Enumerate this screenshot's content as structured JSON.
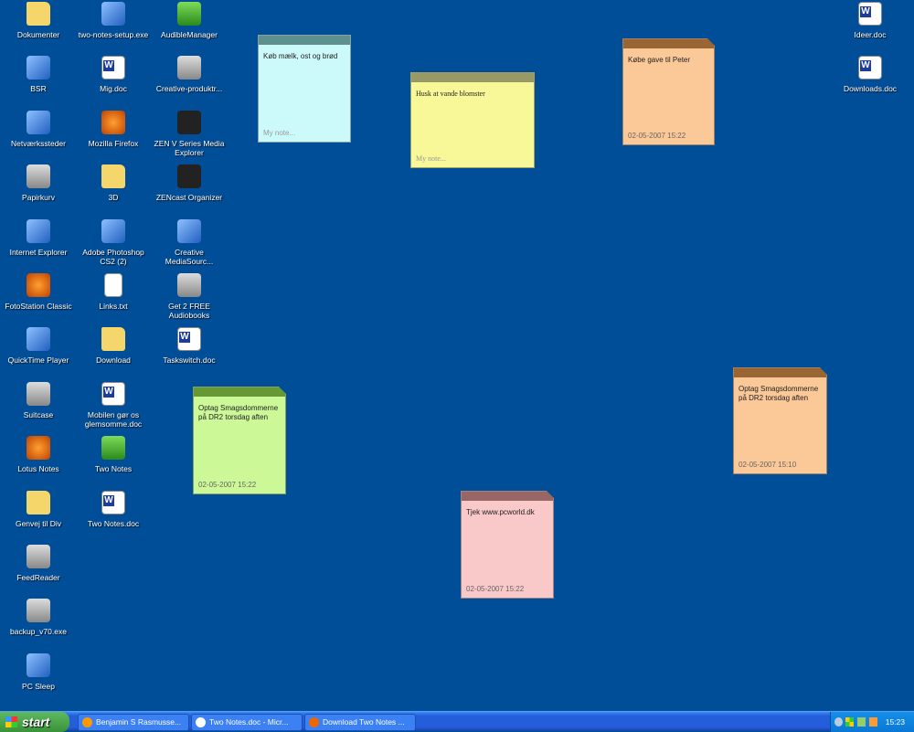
{
  "desktop": {
    "columns": [
      [
        {
          "label": "Dokumenter",
          "icon": "folder"
        },
        {
          "label": "BSR",
          "icon": "app"
        },
        {
          "label": "Netværkssteder",
          "icon": "app"
        },
        {
          "label": "Papirkurv",
          "icon": "gray"
        },
        {
          "label": "Internet Explorer",
          "icon": "app"
        },
        {
          "label": "FotoStation Classic",
          "icon": "orange"
        },
        {
          "label": "QuickTime Player",
          "icon": "app"
        },
        {
          "label": "Suitcase",
          "icon": "gray"
        },
        {
          "label": "Lotus Notes",
          "icon": "orange"
        },
        {
          "label": "Genvej til Div",
          "icon": "folder"
        },
        {
          "label": "FeedReader",
          "icon": "gray"
        },
        {
          "label": "backup_v70.exe",
          "icon": "gray"
        },
        {
          "label": "PC Sleep",
          "icon": "app"
        }
      ],
      [
        {
          "label": "two-notes-setup.exe",
          "icon": "app"
        },
        {
          "label": "Mig.doc",
          "icon": "doc"
        },
        {
          "label": "Mozilla Firefox",
          "icon": "orange"
        },
        {
          "label": "3D",
          "icon": "folder"
        },
        {
          "label": "Adobe Photoshop CS2 (2)",
          "icon": "app"
        },
        {
          "label": "Links.txt",
          "icon": "txt"
        },
        {
          "label": "Download",
          "icon": "folder"
        },
        {
          "label": "Mobilen gør os glemsomme.doc",
          "icon": "doc"
        },
        {
          "label": "Two Notes",
          "icon": "green"
        },
        {
          "label": "Two Notes.doc",
          "icon": "doc"
        }
      ],
      [
        {
          "label": "AudibleManager",
          "icon": "green"
        },
        {
          "label": "Creative-produktr...",
          "icon": "gray"
        },
        {
          "label": "ZEN V Series Media Explorer",
          "icon": "dark"
        },
        {
          "label": "ZENcast Organizer",
          "icon": "dark"
        },
        {
          "label": "Creative MediaSourc...",
          "icon": "app"
        },
        {
          "label": "Get 2 FREE Audiobooks",
          "icon": "gray"
        },
        {
          "label": "Taskswitch.doc",
          "icon": "doc"
        }
      ]
    ],
    "right": [
      {
        "label": "Ideer.doc",
        "icon": "doc"
      },
      {
        "label": "Downloads.doc",
        "icon": "doc"
      }
    ]
  },
  "notes": [
    {
      "text": "Køb mælk, ost og brød",
      "footer": "My note...",
      "bg": "#ccfafa",
      "header": "#5f9090"
    },
    {
      "text": "Husk at vande blomster",
      "footer": "My note...",
      "bg": "#f8f898",
      "header": "#999966"
    },
    {
      "text": "Købe gave til Peter",
      "footer": "02-05-2007 15:22",
      "bg": "#fbc898",
      "header": "#996633"
    },
    {
      "text": "Optag Smagsdommerne på DR2 torsdag aften",
      "footer": "02-05-2007 15:22",
      "bg": "#ccf898",
      "header": "#669933"
    },
    {
      "text": "Tjek www.pcworld.dk",
      "footer": "02-05-2007 15:22",
      "bg": "#f9c8c8",
      "header": "#996666"
    },
    {
      "text": "Optag Smagsdommerne på DR2 torsdag aften",
      "footer": "02-05-2007 15:10",
      "bg": "#fbc898",
      "header": "#996633"
    }
  ],
  "taskbar": {
    "start": "start",
    "tasks": [
      {
        "label": "Benjamin S Rasmusse...",
        "icon": "lotus-notes-icon",
        "color": "#f90"
      },
      {
        "label": "Two Notes.doc - Micr...",
        "icon": "word-icon",
        "color": "#fff"
      },
      {
        "label": "Download Two Notes ...",
        "icon": "firefox-icon",
        "color": "#e60"
      }
    ],
    "clock": "15:23"
  }
}
